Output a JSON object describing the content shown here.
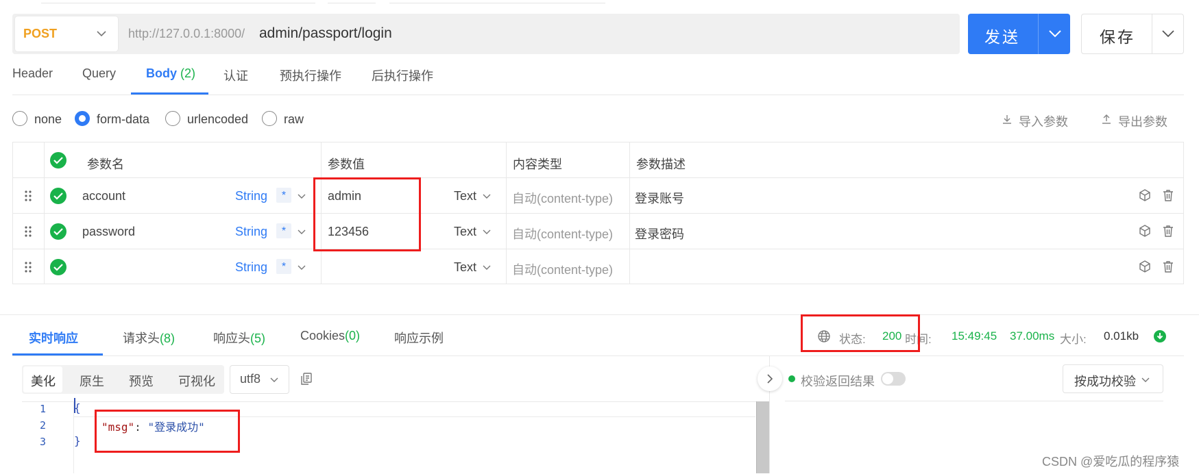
{
  "request": {
    "method": "POST",
    "url_host": "http://127.0.0.1:8000/",
    "url_path": "admin/passport/login",
    "send_label": "发送",
    "save_label": "保存"
  },
  "request_tabs": [
    {
      "label": "Header"
    },
    {
      "label": "Query"
    },
    {
      "label": "Body",
      "count": "(2)"
    },
    {
      "label": "认证"
    },
    {
      "label": "预执行操作"
    },
    {
      "label": "后执行操作"
    }
  ],
  "body_types": [
    "none",
    "form-data",
    "urlencoded",
    "raw"
  ],
  "selected_body_type": "form-data",
  "actions": {
    "import": "导入参数",
    "export": "导出参数"
  },
  "table": {
    "headers": {
      "name": "参数名",
      "value": "参数值",
      "content_type": "内容类型",
      "desc": "参数描述"
    },
    "rows": [
      {
        "name": "account",
        "type": "String",
        "required": "*",
        "value": "admin",
        "kind": "Text",
        "content_type": "自动(content-type)",
        "desc": "登录账号"
      },
      {
        "name": "password",
        "type": "String",
        "required": "*",
        "value": "123456",
        "kind": "Text",
        "content_type": "自动(content-type)",
        "desc": "登录密码"
      },
      {
        "name": "",
        "type": "String",
        "required": "*",
        "value": "",
        "kind": "Text",
        "content_type": "自动(content-type)",
        "desc": ""
      }
    ]
  },
  "response_tabs": [
    {
      "label": "实时响应"
    },
    {
      "label": "请求头",
      "count": "(8)"
    },
    {
      "label": "响应头",
      "count": "(5)"
    },
    {
      "label": "Cookies",
      "count": "(0)"
    },
    {
      "label": "响应示例"
    }
  ],
  "status": {
    "status_label": "状态:",
    "status_code": "200",
    "time_label": "时间:",
    "time": "15:49:45",
    "duration": "37.00ms",
    "size_label": "大小:",
    "size": "0.01kb"
  },
  "formats": [
    "美化",
    "原生",
    "预览",
    "可视化"
  ],
  "encoding": "utf8",
  "code_lines": [
    {
      "no": "1",
      "text": "{"
    },
    {
      "no": "2",
      "key": "\"msg\"",
      "colon": ": ",
      "value": "\"登录成功\""
    },
    {
      "no": "3",
      "text": "}"
    }
  ],
  "verify": {
    "label": "校验返回结果",
    "button": "按成功校验"
  },
  "watermark": "CSDN @爱吃瓜的程序猿",
  "colors": {
    "primary": "#2f7bf5",
    "success": "#19b24a",
    "method": "#f0a020",
    "highlight": "#ee1d1d"
  }
}
